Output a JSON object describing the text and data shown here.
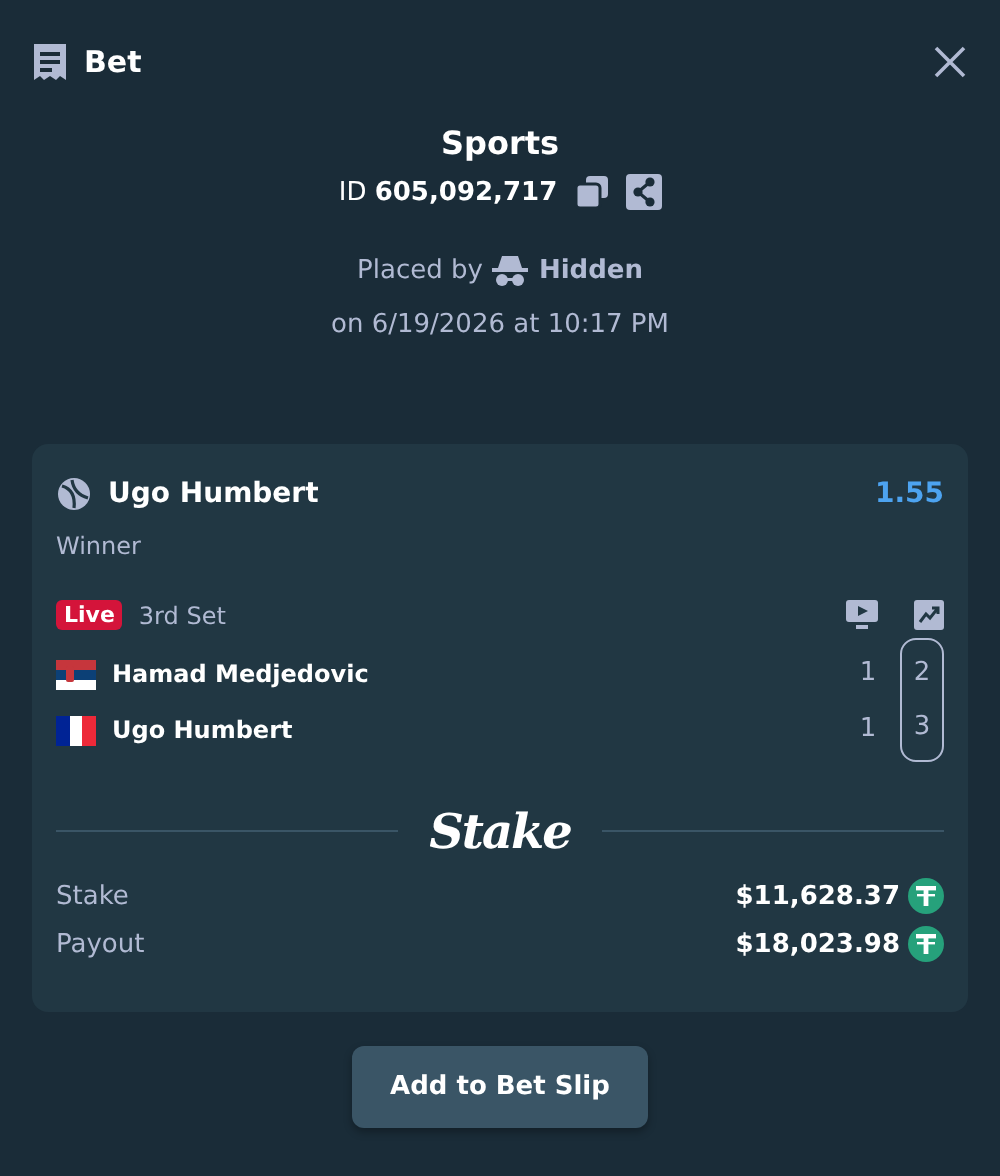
{
  "header": {
    "title": "Bet"
  },
  "summary": {
    "title": "Sports",
    "id_label": "ID",
    "id_value": "605,092,717",
    "placed_by": "Placed by",
    "user": "Hidden",
    "date": "on 6/19/2026 at 10:17 PM"
  },
  "selection": {
    "name": "Ugo Humbert",
    "odds": "1.55",
    "market": "Winner",
    "live_badge": "Live",
    "period": "3rd Set",
    "players": [
      {
        "kind": "serbia",
        "name": "Hamad Medjedovic",
        "scores": [
          "1",
          "2"
        ]
      },
      {
        "kind": "france",
        "name": "Ugo Humbert",
        "scores": [
          "1",
          "3"
        ]
      }
    ],
    "logo": "Stake",
    "amounts": [
      {
        "label": "Stake",
        "value": "$11,628.37"
      },
      {
        "label": "Payout",
        "value": "$18,023.98"
      }
    ]
  },
  "button": "Add to Bet Slip"
}
